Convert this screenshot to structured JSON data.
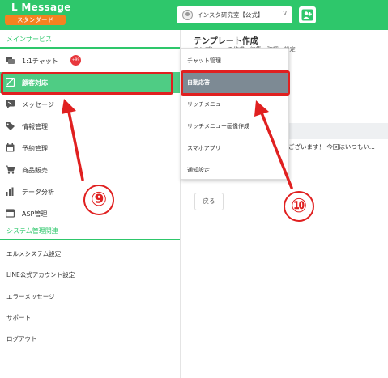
{
  "header": {
    "title": "L Message",
    "plan_badge": "スタンダード",
    "account_name": "インスタ研究室【公式】",
    "account_chevron": "∨",
    "colors": {
      "brand": "#2ec76b",
      "badge": "#f58220"
    }
  },
  "sidebar": {
    "section_main": "メインサービス",
    "items": [
      {
        "label": "1:1チャット",
        "icon": "chat-icon"
      },
      {
        "label": "顧客対応",
        "icon": "customer-icon",
        "active": true
      },
      {
        "label": "メッセージ",
        "icon": "message-icon"
      },
      {
        "label": "情報管理",
        "icon": "tag-icon"
      },
      {
        "label": "予約管理",
        "icon": "calendar-icon"
      },
      {
        "label": "商品販売",
        "icon": "cart-icon"
      },
      {
        "label": "データ分析",
        "icon": "chart-icon"
      },
      {
        "label": "ASP管理",
        "icon": "asp-icon"
      }
    ],
    "chat_badge": "+99",
    "section_system": "システム管理関連",
    "system_items": [
      "エルメシステム設定",
      "LINE公式アカウント設定",
      "エラーメッセージ",
      "サポート",
      "ログアウト"
    ]
  },
  "main": {
    "page_title": "テンプレート作成",
    "page_sub": "テンプレートの作成・編集・確認・設定",
    "row_text": "ございます！ 今回はいつもい...",
    "back_button": "戻る"
  },
  "dropdown": {
    "items": [
      {
        "label": "チャット管理"
      },
      {
        "label": "自動応答",
        "active": true
      },
      {
        "label": "リッチメニュー"
      },
      {
        "label": "リッチメニュー画像作成"
      },
      {
        "label": "スマホアプリ"
      },
      {
        "label": "通知設定"
      }
    ]
  },
  "annotations": {
    "step1": "⑨",
    "step2": "⑩",
    "color": "#e02020"
  }
}
